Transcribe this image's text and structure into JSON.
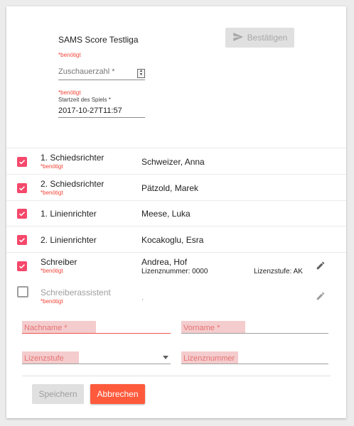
{
  "header": {
    "league_title": "SAMS Score Testliga",
    "required_note": "*benötigt",
    "confirm_label": "Bestätigen"
  },
  "spectators": {
    "placeholder": "Zuschauerzahl *"
  },
  "start_time": {
    "required_note": "*benötigt",
    "label": "Startzeit des Spiels *",
    "value": "2017-10-27T11:57"
  },
  "officials": [
    {
      "role": "1. Schiedsrichter",
      "required": "*benötigt",
      "name": "Schweizer, Anna",
      "checked": true
    },
    {
      "role": "2. Schiedsrichter",
      "required": "*benötigt",
      "name": "Pätzold, Marek",
      "checked": true
    },
    {
      "role": "1. Linienrichter",
      "required": "",
      "name": "Meese, Luka",
      "checked": true
    },
    {
      "role": "2. Linienrichter",
      "required": "",
      "name": "Kocakoglu, Esra",
      "checked": true
    },
    {
      "role": "Schreiber",
      "required": "*benötigt",
      "name": "Andrea, Hof",
      "license_number": "Lizenznummer: 0000",
      "license_level": "Lizenzstufe: AK",
      "checked": true
    },
    {
      "role": "Schreiberassistent",
      "required": "*benötigt",
      "name": ",",
      "checked": false
    }
  ],
  "form": {
    "lastname_placeholder": "Nachname *",
    "firstname_placeholder": "Vorname *",
    "license_level_placeholder": "Lizenzstufe",
    "license_number_placeholder": "Lizenznummer"
  },
  "actions": {
    "save_label": "Speichern",
    "cancel_label": "Abbrechen"
  },
  "colors": {
    "accent_pink": "#f5486b",
    "cancel_orange": "#ff5a3c",
    "required_red": "#f44336"
  }
}
